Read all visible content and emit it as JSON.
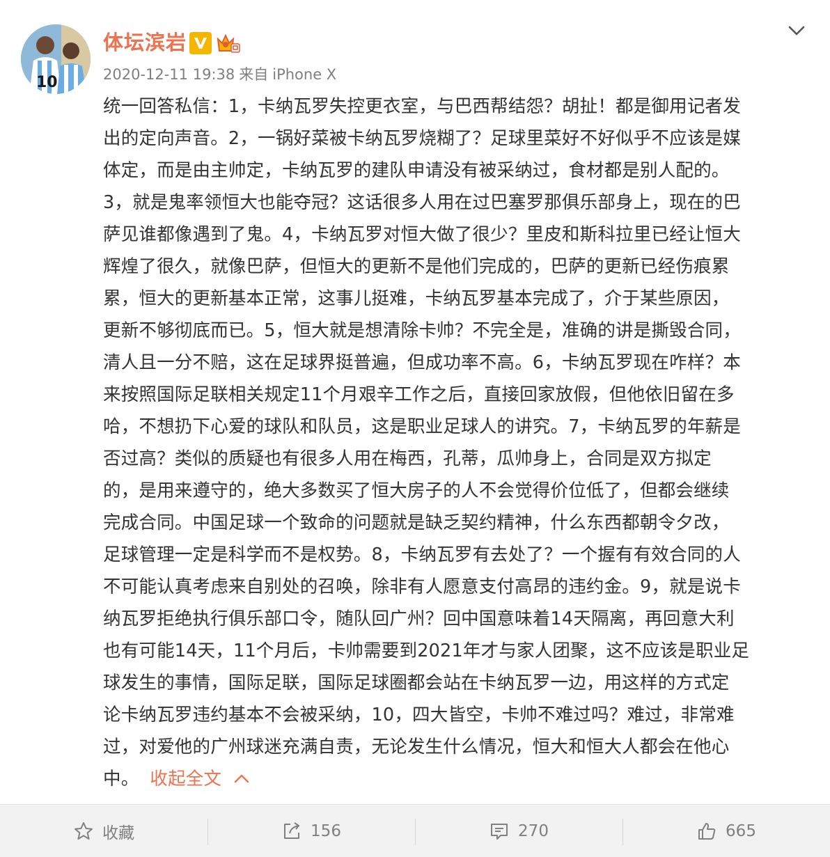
{
  "post": {
    "author": "体坛滨岩",
    "timestamp": "2020-12-11 19:38",
    "source_prefix": "来自",
    "source_device": "iPhone X",
    "avatar_jersey_number": "10",
    "menu_icon": "chevron-down-icon",
    "lines": [
      "统一回答私信：1，卡纳瓦罗失控更衣室，与巴西帮结怨？胡扯！都是御用记者发",
      "出的定向声音。2，一锅好菜被卡纳瓦罗烧糊了？足球里菜好不好似乎不应该是媒",
      "体定，而是由主帅定，卡纳瓦罗的建队申请没有被采纳过，食材都是别人配的。",
      "3，就是鬼率领恒大也能夺冠？这话很多人用在过巴塞罗那俱乐部身上，现在的巴",
      "萨见谁都像遇到了鬼。4，卡纳瓦罗对恒大做了很少？里皮和斯科拉里已经让恒大",
      "辉煌了很久，就像巴萨，但恒大的更新不是他们完成的，巴萨的更新已经伤痕累",
      "累，恒大的更新基本正常，这事儿挺难，卡纳瓦罗基本完成了，介于某些原因，",
      "更新不够彻底而已。5，恒大就是想清除卡帅？不完全是，准确的讲是撕毁合同，",
      "清人且一分不赔，这在足球界挺普遍，但成功率不高。6，卡纳瓦罗现在咋样？本",
      "来按照国际足联相关规定11个月艰辛工作之后，直接回家放假，但他依旧留在多",
      "哈，不想扔下心爱的球队和队员，这是职业足球人的讲究。7，卡纳瓦罗的年薪是",
      "否过高？类似的质疑也有很多人用在梅西，孔蒂，瓜帅身上，合同是双方拟定",
      "的，是用来遵守的，绝大多数买了恒大房子的人不会觉得价位低了，但都会继续",
      "完成合同。中国足球一个致命的问题就是缺乏契约精神，什么东西都朝令夕改，",
      "足球管理一定是科学而不是权势。8，卡纳瓦罗有去处了？一个握有有效合同的人",
      "不可能认真考虑来自别处的召唤，除非有人愿意支付高昂的违约金。9，就是说卡",
      "纳瓦罗拒绝执行俱乐部口令，随队回广州？回中国意味着14天隔离，再回意大利",
      "也有可能14天，11个月后，卡帅需要到2021年才与家人团聚，这不应该是职业足",
      "球发生的事情，国际足联，国际足球圈都会站在卡纳瓦罗一边，用这样的方式定",
      "论卡纳瓦罗违约基本不会被采纳，10，四大皆空，卡帅不难过吗？难过，非常难",
      "过，对爱他的广州球迷充满自责，无论发生什么情况，恒大和恒大人都会在他心"
    ],
    "last_line": "中。",
    "collapse_label": "收起全文"
  },
  "actions": {
    "favorite": {
      "icon": "star-icon",
      "label": "收藏"
    },
    "repost": {
      "icon": "repost-icon",
      "count": "156"
    },
    "comment": {
      "icon": "comment-icon",
      "count": "270"
    },
    "like": {
      "icon": "thumbs-up-icon",
      "count": "665"
    }
  },
  "colors": {
    "accent": "#eb7350",
    "text": "#333333",
    "meta": "#808080",
    "action_bar_bg": "#f2f2f2",
    "badge_gold": "#f5b500"
  }
}
